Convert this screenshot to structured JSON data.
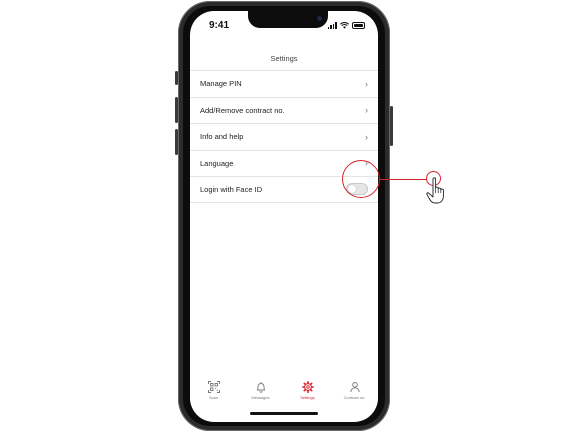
{
  "status_bar": {
    "time": "9:41"
  },
  "header": {
    "title": "Settings"
  },
  "settings": {
    "items": [
      {
        "label": "Manage PIN",
        "control": "chevron"
      },
      {
        "label": "Add/Remove contract no.",
        "control": "chevron"
      },
      {
        "label": "Info and help",
        "control": "chevron"
      },
      {
        "label": "Language",
        "control": "chevron"
      },
      {
        "label": "Login with Face ID",
        "control": "toggle",
        "toggle_on": false
      }
    ],
    "chevron_glyph": "›"
  },
  "tabbar": {
    "tabs": [
      {
        "label": "Scan",
        "icon": "qr-scan-icon",
        "active": false
      },
      {
        "label": "Messages",
        "icon": "bell-icon",
        "active": false
      },
      {
        "label": "Settings",
        "icon": "gear-icon",
        "active": true
      },
      {
        "label": "Contract no.",
        "icon": "person-icon",
        "active": false
      }
    ]
  },
  "annotation": {
    "target": "Login with Face ID toggle",
    "icon": "hand-pointer-icon"
  },
  "colors": {
    "accent": "#d4232b",
    "text": "#222222",
    "divider": "#e4e4e4",
    "toggle_off": "#e6e6e6"
  }
}
